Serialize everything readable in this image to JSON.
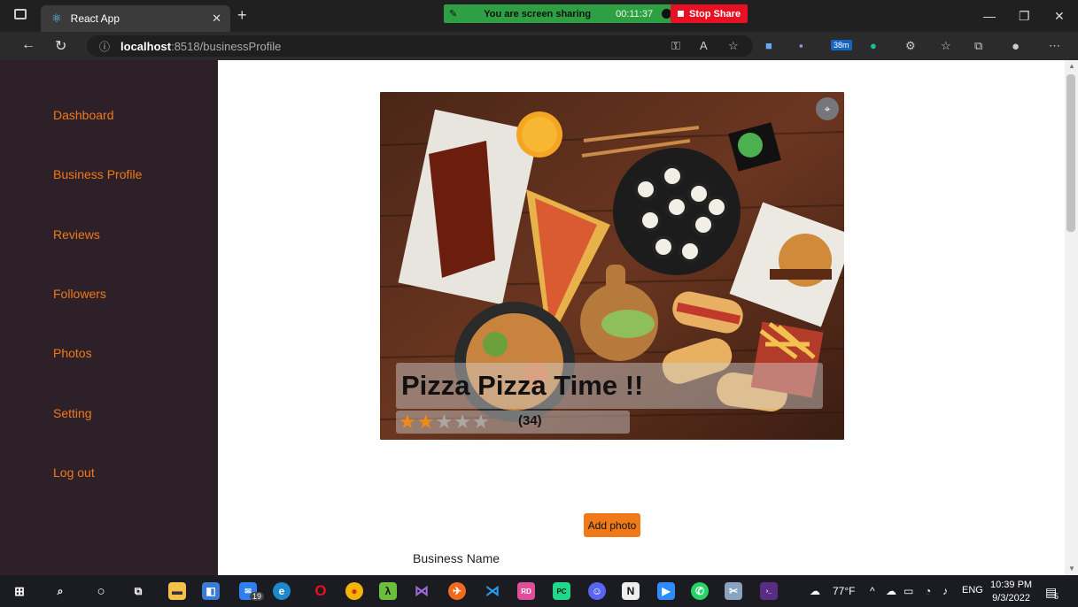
{
  "browser": {
    "tab_title": "React App",
    "sharing_text": "You are screen sharing",
    "sharing_time": "00:11:37",
    "stop_share": "Stop Share",
    "url_host": "localhost",
    "url_path": ":8518/businessProfile",
    "ext_badge": "38m"
  },
  "sidebar": {
    "items": [
      {
        "label": "Dashboard"
      },
      {
        "label": "Business Profile"
      },
      {
        "label": "Reviews"
      },
      {
        "label": "Followers"
      },
      {
        "label": "Photos"
      },
      {
        "label": "Setting"
      },
      {
        "label": "Log out"
      }
    ]
  },
  "profile": {
    "business_title": "Pizza Pizza Time !!",
    "rating_stars": 2,
    "rating_max": 5,
    "review_count": "(34)",
    "add_photo_label": "Add photo",
    "business_name_label": "Business Name"
  },
  "taskbar": {
    "mail_badge": "19",
    "weather": "77°F",
    "lang": "ENG",
    "time": "10:39 PM",
    "date": "9/3/2022",
    "notif_badge": "5"
  },
  "colors": {
    "sidebar_bg": "#2d2029",
    "accent": "#f07a1a"
  }
}
